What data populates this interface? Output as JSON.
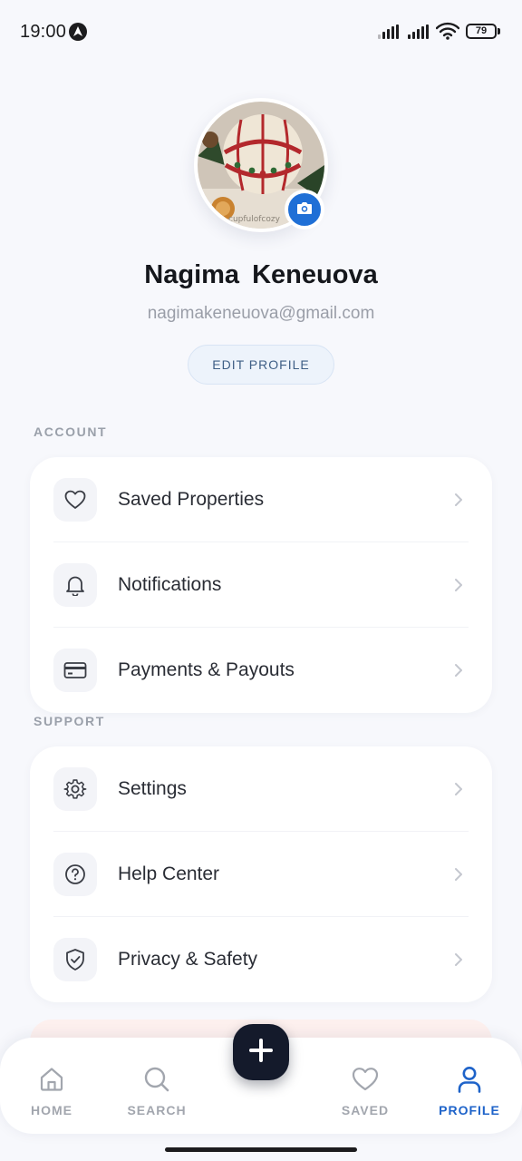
{
  "status_bar": {
    "time": "19:00",
    "app_icon": "navigation-icon",
    "battery": "79"
  },
  "profile": {
    "name": "Nagima  Keneuova",
    "email": "nagimakeneuova@gmail.com",
    "edit_label": "EDIT PROFILE",
    "avatar_watermark": "cupfulofcozy"
  },
  "sections": {
    "account": {
      "label": "ACCOUNT",
      "items": [
        {
          "label": "Saved Properties",
          "icon": "heart-icon"
        },
        {
          "label": "Notifications",
          "icon": "bell-icon"
        },
        {
          "label": "Payments & Payouts",
          "icon": "credit-card-icon"
        }
      ]
    },
    "support": {
      "label": "SUPPORT",
      "items": [
        {
          "label": "Settings",
          "icon": "gear-icon"
        },
        {
          "label": "Help Center",
          "icon": "help-circle-icon"
        },
        {
          "label": "Privacy & Safety",
          "icon": "shield-check-icon"
        }
      ]
    }
  },
  "bottom_nav": {
    "items": [
      {
        "label": "HOME",
        "icon": "home-icon",
        "active": false
      },
      {
        "label": "SEARCH",
        "icon": "search-icon",
        "active": false
      },
      {
        "label": "SAVED",
        "icon": "heart-icon",
        "active": false
      },
      {
        "label": "PROFILE",
        "icon": "user-icon",
        "active": true
      }
    ],
    "fab_icon": "plus-icon"
  },
  "colors": {
    "accent": "#1e63c9",
    "fab": "#141a2b",
    "background": "#f7f8fc",
    "inactive_nav": "#a2a6ae"
  }
}
